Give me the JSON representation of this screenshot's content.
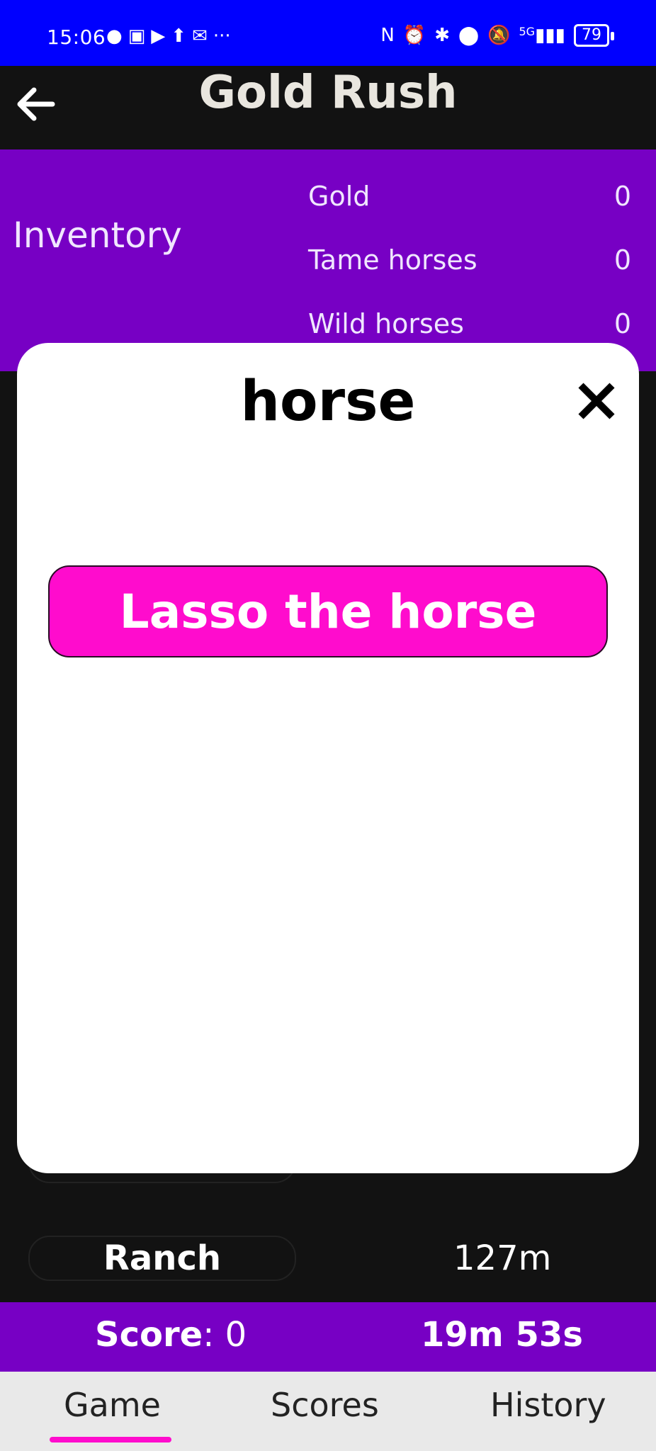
{
  "status_bar": {
    "time": "15:06",
    "left_icons": [
      "chat-icon",
      "teams-icon",
      "youtube-icon",
      "upload-icon",
      "gmail-icon",
      "more-icon"
    ],
    "right_icons": [
      "nfc-icon",
      "alarm-icon",
      "bluetooth-icon",
      "location-icon",
      "mute-icon",
      "signal-5g-icon"
    ],
    "network": "5G",
    "battery": "79"
  },
  "app_bar": {
    "title": "Gold Rush"
  },
  "inventory": {
    "label": "Inventory",
    "items": [
      {
        "name": "Gold",
        "value": "0"
      },
      {
        "name": "Tame horses",
        "value": "0"
      },
      {
        "name": "Wild horses",
        "value": "0"
      }
    ]
  },
  "modal": {
    "title": "horse",
    "action_label": "Lasso the horse"
  },
  "location_row": {
    "label": "Ranch",
    "distance": "127m"
  },
  "score_bar": {
    "score_label": "Score",
    "score_value": ": 0",
    "timer": "19m 53s"
  },
  "bottom_nav": {
    "tabs": [
      "Game",
      "Scores",
      "History"
    ],
    "active": "Game"
  },
  "colors": {
    "status_bar": "#0000ff",
    "panel": "#7700c4",
    "accent": "#ff0ccd",
    "background": "#121212"
  }
}
